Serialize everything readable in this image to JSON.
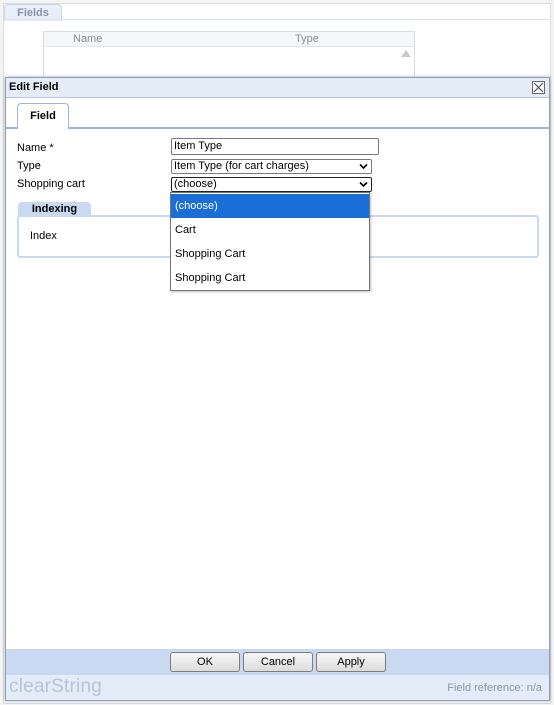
{
  "background": {
    "tab_label": "Fields",
    "grid_columns": [
      "Name",
      "Type"
    ]
  },
  "dialog": {
    "title": "Edit Field",
    "close_icon": "close-box-icon",
    "tabs": [
      {
        "label": "Field",
        "active": true
      }
    ],
    "form": {
      "name_label": "Name *",
      "name_value": "Item Type",
      "type_label": "Type",
      "type_value": "Item Type (for cart charges)",
      "cart_label": "Shopping cart",
      "cart_value": "(choose)"
    },
    "dropdown_options": [
      {
        "label": "(choose)",
        "selected": true
      },
      {
        "label": "Cart",
        "selected": false
      },
      {
        "label": "Shopping Cart",
        "selected": false
      },
      {
        "label": "Shopping Cart",
        "selected": false
      }
    ],
    "section": {
      "title": "Indexing",
      "index_label": "Index"
    },
    "buttons": {
      "ok": "OK",
      "cancel": "Cancel",
      "apply": "Apply"
    },
    "footer": {
      "brand": "clearString",
      "field_reference": "Field reference: n/a"
    }
  },
  "colors": {
    "accent": "#c9d9f1",
    "title_bar": "#e4ecf8",
    "selected_option": "#1a6ed8"
  }
}
